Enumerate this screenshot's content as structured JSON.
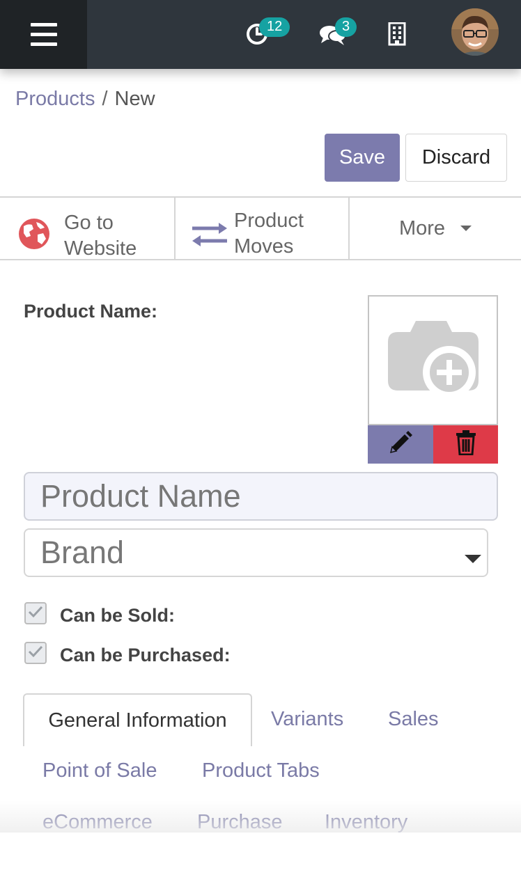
{
  "navbar": {
    "activity_count": "12",
    "messages_count": "3"
  },
  "breadcrumb": {
    "parent": "Products",
    "separator": "/",
    "current": "New"
  },
  "actions": {
    "save_label": "Save",
    "discard_label": "Discard"
  },
  "smart_buttons": {
    "website_line1": "Go to",
    "website_line2": "Website",
    "moves_line1": "Product",
    "moves_line2": "Moves",
    "more_label": "More"
  },
  "form": {
    "product_name_label": "Product Name:",
    "product_name_placeholder": "Product Name",
    "brand_placeholder": "Brand",
    "can_be_sold_label": "Can be Sold:",
    "can_be_purchased_label": "Can be Purchased:"
  },
  "tabs": {
    "general": "General Information",
    "variants": "Variants",
    "sales": "Sales",
    "pos": "Point of Sale",
    "product_tabs": "Product Tabs",
    "ecommerce": "eCommerce",
    "purchase": "Purchase",
    "inventory": "Inventory"
  },
  "colors": {
    "navbar": "#2f363d",
    "primary": "#7c7bad",
    "danger": "#de3a48",
    "badge": "#16a2a2"
  }
}
